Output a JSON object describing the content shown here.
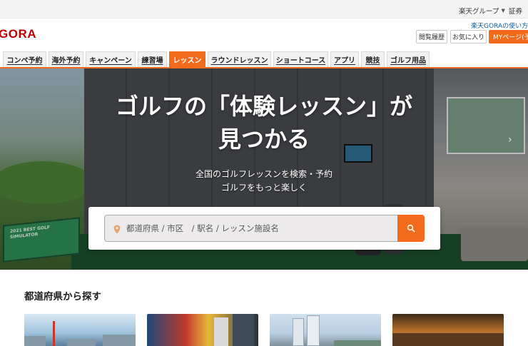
{
  "utility": {
    "group_label": "楽天グループ",
    "securities_label": "証券"
  },
  "header": {
    "logo": "GORA",
    "howto_link": "楽天GORAの使い方",
    "history_button": "閲覧履歴",
    "favorites_button": "お気に入り",
    "mypage_button": "MYページ(予"
  },
  "tabs": [
    {
      "label": "コンペ予約"
    },
    {
      "label": "海外予約"
    },
    {
      "label": "キャンペーン"
    },
    {
      "label": "練習場"
    },
    {
      "label": "レッスン"
    },
    {
      "label": "ラウンドレッスン"
    },
    {
      "label": "ショートコース"
    },
    {
      "label": "アプリ"
    },
    {
      "label": "競技"
    },
    {
      "label": "ゴルフ用品"
    }
  ],
  "active_tab": "レッスン",
  "hero": {
    "title_line1": "ゴルフの「体験レッスン」が",
    "title_line2": "見つかる",
    "subtitle_line1": "全国のゴルフレッスンを検索・予約",
    "subtitle_line2": "ゴルフをもっと楽しく",
    "banner_text": "2021 BEST GOLF SIMULATOR"
  },
  "search": {
    "placeholder": "都道府県 / 市区　/ 駅名 / レッスン施設名",
    "value": ""
  },
  "sections": {
    "prefecture_title": "都道府県から探す"
  },
  "colors": {
    "accent": "#f26b1d",
    "brand": "#bf0000",
    "link": "#0b5ca6"
  },
  "icons": {
    "pin": "map-pin-icon",
    "search": "search-icon",
    "caret": "chevron-down-icon",
    "next": "chevron-right-icon"
  }
}
